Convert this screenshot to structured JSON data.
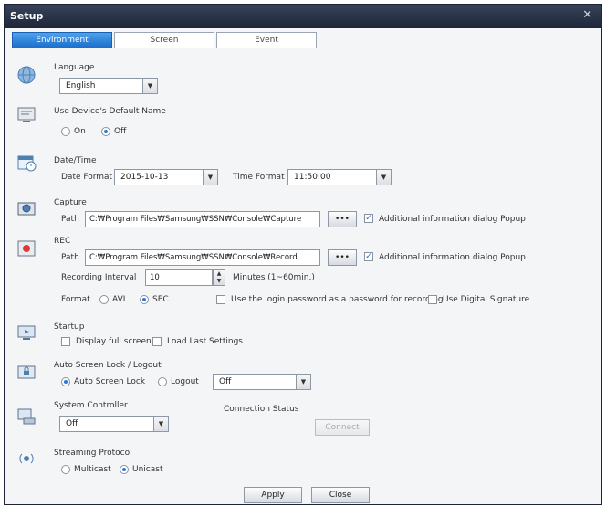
{
  "window": {
    "title": "Setup",
    "close_glyph": "✕"
  },
  "tabs": [
    {
      "label": "Environment",
      "active": true
    },
    {
      "label": "Screen",
      "active": false
    },
    {
      "label": "Event",
      "active": false
    }
  ],
  "language": {
    "title": "Language",
    "value": "English"
  },
  "default_name": {
    "title": "Use Device's Default Name",
    "on_label": "On",
    "off_label": "Off",
    "selected": "Off"
  },
  "datetime": {
    "title": "Date/Time",
    "date_format_label": "Date Format",
    "date_format_value": "2015-10-13",
    "time_format_label": "Time Format",
    "time_format_value": "11:50:00"
  },
  "capture": {
    "title": "Capture",
    "path_label": "Path",
    "path_value": "C:₩Program Files₩Samsung₩SSN₩Console₩Capture",
    "browse_label": "•••",
    "popup_label": "Additional information dialog Popup",
    "popup_checked": true
  },
  "rec": {
    "title": "REC",
    "path_label": "Path",
    "path_value": "C:₩Program Files₩Samsung₩SSN₩Console₩Record",
    "browse_label": "•••",
    "popup_label": "Additional information dialog Popup",
    "popup_checked": true,
    "interval_label": "Recording Interval",
    "interval_value": "10",
    "interval_unit": "Minutes (1~60min.)",
    "format_label": "Format",
    "avi_label": "AVI",
    "sec_label": "SEC",
    "format_selected": "SEC",
    "login_pw_label": "Use the login password as a password for recording",
    "digital_sig_label": "Use Digital Signature"
  },
  "startup": {
    "title": "Startup",
    "full_screen_label": "Display full screen",
    "load_last_label": "Load Last Settings"
  },
  "autolock": {
    "title": "Auto Screen Lock / Logout",
    "lock_label": "Auto Screen Lock",
    "logout_label": "Logout",
    "selected": "Auto Screen Lock",
    "value": "Off"
  },
  "syscontroller": {
    "title": "System Controller",
    "value": "Off",
    "connection_label": "Connection Status",
    "connect_label": "Connect"
  },
  "streaming": {
    "title": "Streaming Protocol",
    "multicast_label": "Multicast",
    "unicast_label": "Unicast",
    "selected": "Unicast"
  },
  "footer": {
    "apply_label": "Apply",
    "close_label": "Close"
  },
  "colors": {
    "titlebar": "#1e2638",
    "tab_active": "#1b6fcc",
    "accent": "#2a7bd8"
  }
}
